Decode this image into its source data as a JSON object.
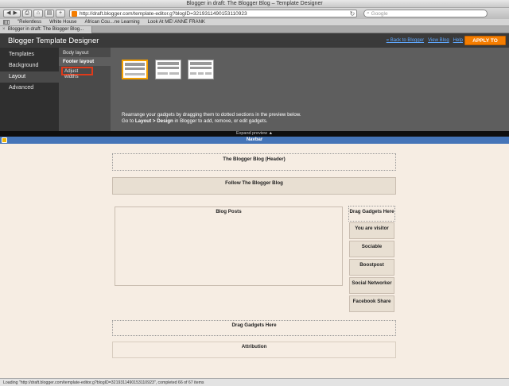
{
  "window": {
    "title": "Blogger in draft: The Blogger Blog – Template Designer"
  },
  "browser": {
    "url": "http://draft.blogger.com/template-editor.g?blogID=3219311490153110923",
    "search_placeholder": "Google",
    "bookmarks": [
      "\"Relentless",
      "White House",
      "African Cou…ne Learning",
      "Look At ME! ANNE FRANK"
    ],
    "tab_title": "Blogger in draft: The Blogger Blog..."
  },
  "designer": {
    "title": "Blogger Template Designer",
    "links": {
      "back": "« Back to Blogger",
      "view": "View Blog",
      "help": "Help"
    },
    "apply_label": "APPLY TO BLOG",
    "nav": [
      "Templates",
      "Background",
      "Layout",
      "Advanced"
    ],
    "subnav": [
      "Body layout",
      "Footer layout",
      "Adjust widths"
    ],
    "instructions": {
      "line1": "Rearrange your gadgets by dragging them to dotted sections in the preview below.",
      "line2_pre": "Go to ",
      "line2_bold": "Layout > Design",
      "line2_post": " in Blogger to add, remove, or edit gadgets."
    },
    "expand_label": "Expand preview"
  },
  "layout": {
    "navbar_label": "Navbar",
    "header_label": "The Blogger Blog (Header)",
    "follow_label": "Follow The Blogger Blog",
    "blog_posts_label": "Blog Posts",
    "drag_sidebar_label": "Drag Gadgets Here",
    "sidebar_gadgets": [
      "You are visitor",
      "Sociable",
      "Boostpost",
      "Social Networker",
      "Facebook Share"
    ],
    "drag_footer_label": "Drag Gadgets Here",
    "attribution_label": "Attribution"
  },
  "status": {
    "text": "Loading \"http://draft.blogger.com/template-editor.g?blogID=3219311490153110923\", completed 66 of 67 items"
  },
  "colors": {
    "accent": "#f57d00",
    "navbar": "#4575b8",
    "link": "#5fa8ff",
    "highlight": "#e03a1a"
  }
}
